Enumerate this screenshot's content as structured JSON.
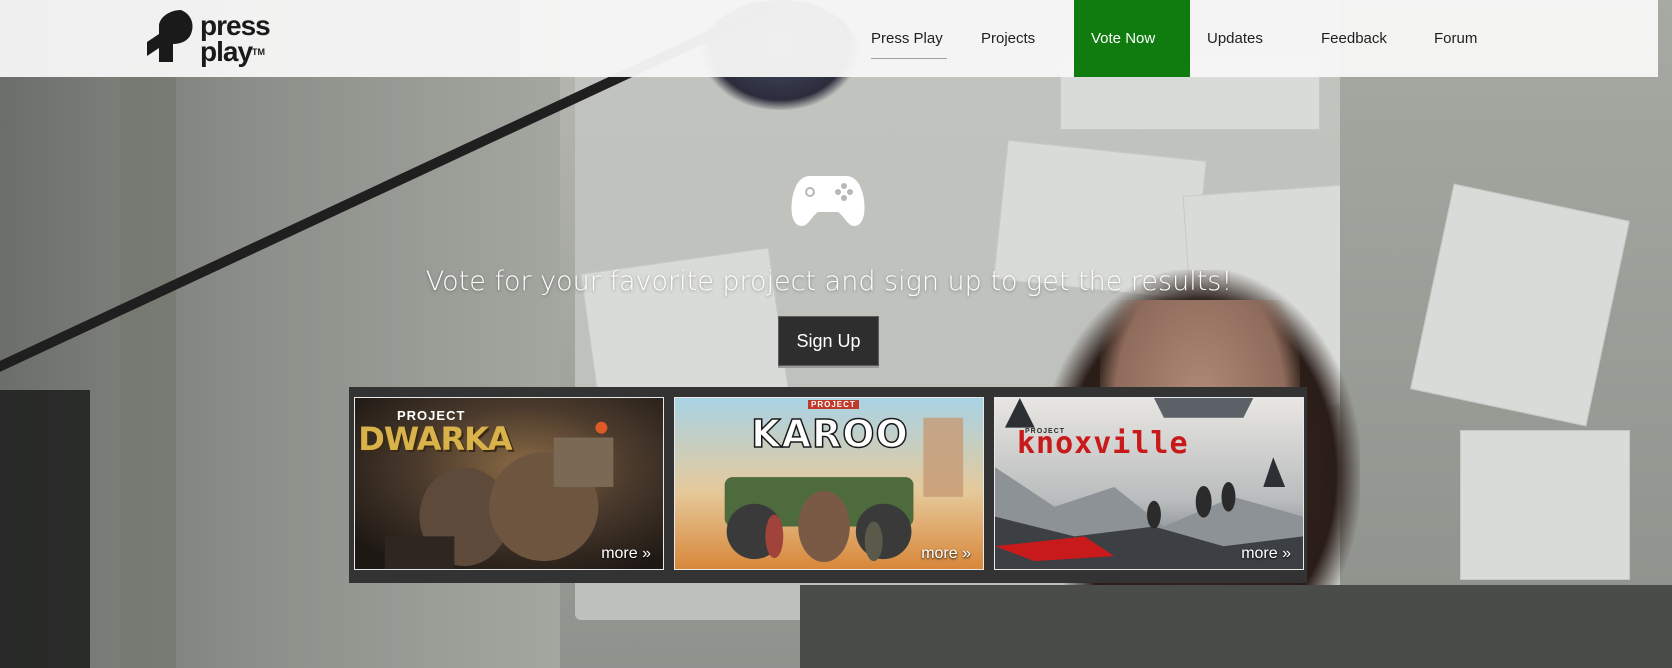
{
  "brand": {
    "line1": "press",
    "line2": "play",
    "tm": "TM",
    "logo_icon": "press-play-logo"
  },
  "nav": {
    "items": [
      {
        "label": "Press Play",
        "active": true
      },
      {
        "label": "Projects"
      },
      {
        "label": "Vote Now",
        "highlight": "#107c10"
      },
      {
        "label": "Updates"
      },
      {
        "label": "Feedback"
      },
      {
        "label": "Forum"
      }
    ]
  },
  "hero": {
    "icon": "gamepad-icon",
    "tagline": "Vote for your favorite project and sign up to get the results!",
    "signup_label": "Sign Up"
  },
  "projects": [
    {
      "prefix": "PROJECT",
      "name": "DWARKA",
      "more": "more »"
    },
    {
      "prefix": "PROJECT",
      "name": "KAROO",
      "more": "more »"
    },
    {
      "prefix": "PROJECT",
      "name": "knoxville",
      "more": "more »"
    }
  ],
  "colors": {
    "accent": "#107c10",
    "header_bg": "#f6f6f6",
    "strip_bg": "#333333"
  }
}
